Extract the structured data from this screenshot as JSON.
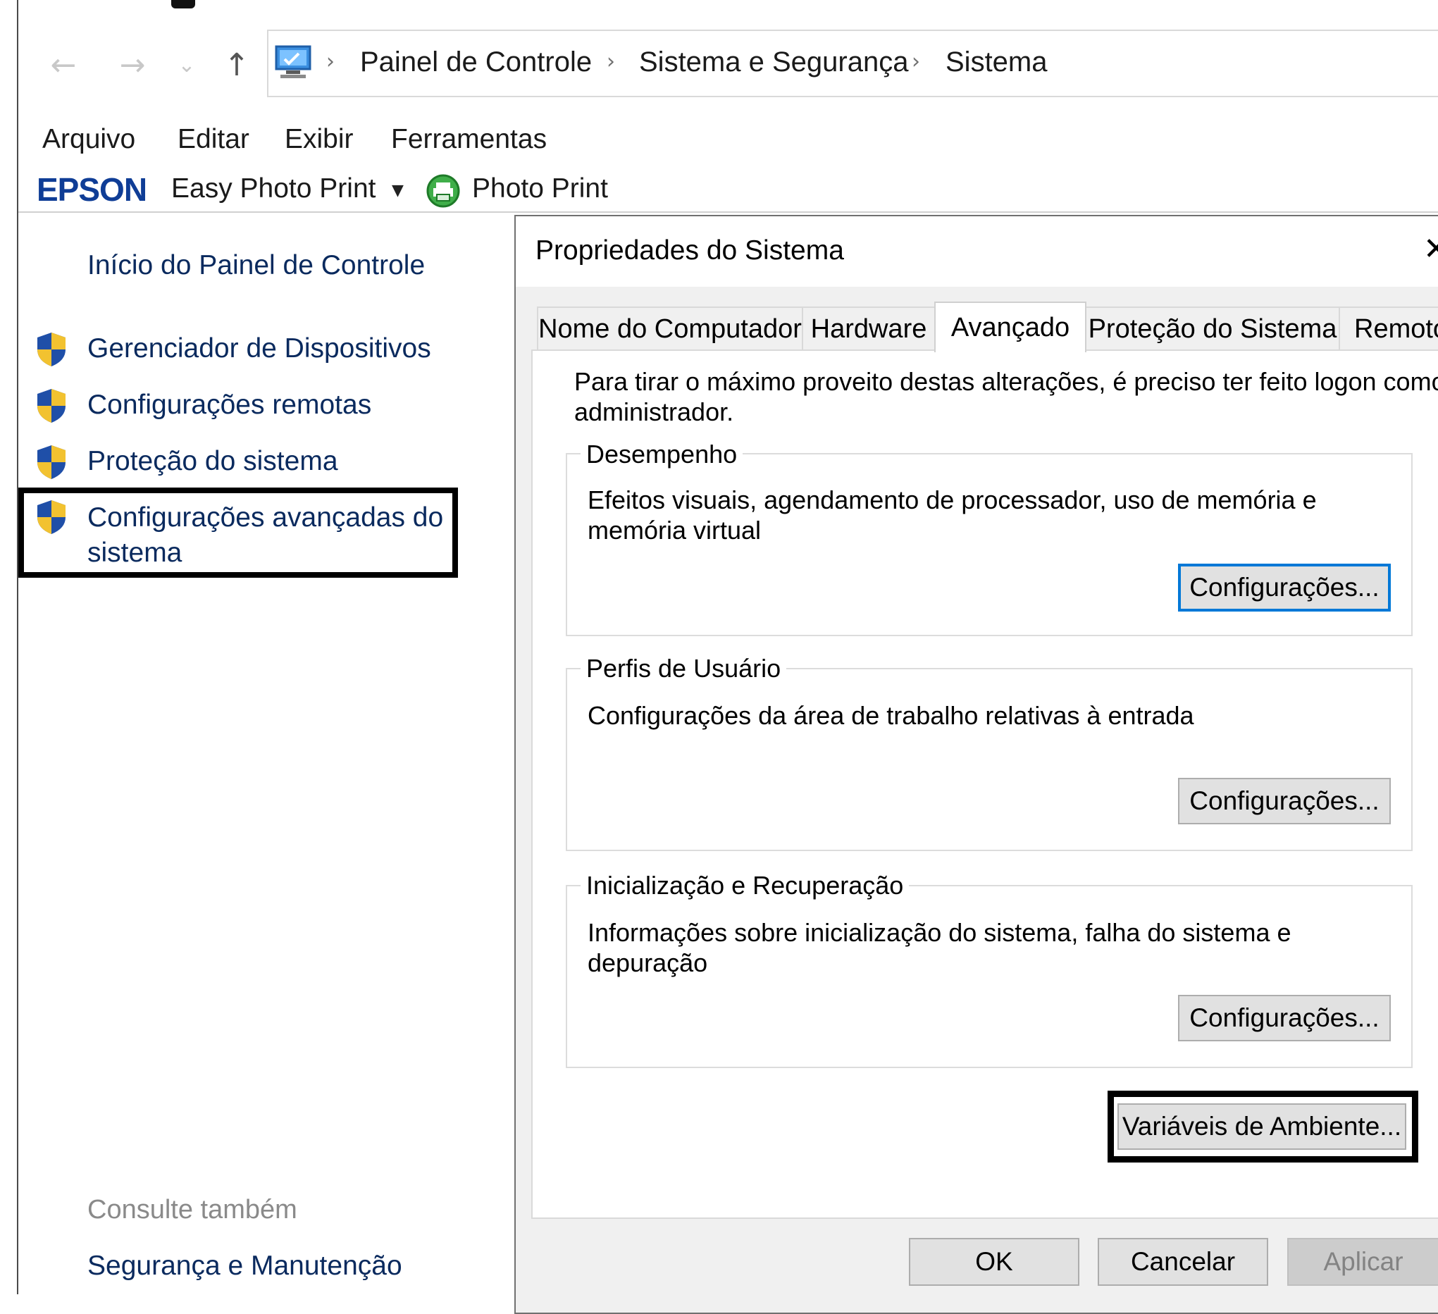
{
  "address": {
    "breadcrumbs": [
      "Painel de Controle",
      "Sistema e Segurança",
      "Sistema"
    ],
    "separator": "›"
  },
  "nav": {
    "back": "←",
    "forward": "→",
    "recent": "⌄",
    "up": "↑"
  },
  "menubar": {
    "items": [
      "Arquivo",
      "Editar",
      "Exibir",
      "Ferramentas"
    ]
  },
  "toolbar": {
    "brand": "EPSON",
    "app_label": "Easy Photo Print",
    "dropdown_glyph": "▼",
    "photo_print_label": "Photo Print"
  },
  "sidebar": {
    "home_link": "Início do Painel de Controle",
    "links": [
      "Gerenciador de Dispositivos",
      "Configurações remotas",
      "Proteção do sistema"
    ],
    "advanced_link_line1": "Configurações avançadas do",
    "advanced_link_line2": "sistema",
    "see_also": "Consulte também",
    "see_also_links": [
      "Segurança e Manutenção"
    ]
  },
  "dialog": {
    "title": "Propriedades do Sistema",
    "close_glyph": "✕",
    "tabs": [
      "Nome do Computador",
      "Hardware",
      "Avançado",
      "Proteção do Sistema",
      "Remoto"
    ],
    "active_tab": "Avançado",
    "admin_note_line1": "Para tirar o máximo proveito destas alterações, é preciso ter feito logon como",
    "admin_note_line2": "administrador.",
    "groups": {
      "performance": {
        "title": "Desempenho",
        "desc_line1": "Efeitos visuais, agendamento de processador, uso de memória e",
        "desc_line2": "memória virtual",
        "button": "Configurações..."
      },
      "profiles": {
        "title": "Perfis de Usuário",
        "desc_line1": "Configurações da área de trabalho relativas à entrada",
        "button": "Configurações..."
      },
      "startup": {
        "title": "Inicialização e Recuperação",
        "desc_line1": "Informações sobre inicialização do sistema, falha do sistema e",
        "desc_line2": "depuração",
        "button": "Configurações..."
      }
    },
    "env_button": "Variáveis de Ambiente...",
    "ok": "OK",
    "cancel": "Cancelar",
    "apply": "Aplicar"
  },
  "colors": {
    "link": "#0a2a5e",
    "epson_brand": "#0f3d96",
    "focus_border": "#0078d7",
    "highlight_box": "#000000",
    "shield_blue": "#1f4fa8",
    "shield_yellow": "#f2c230"
  }
}
